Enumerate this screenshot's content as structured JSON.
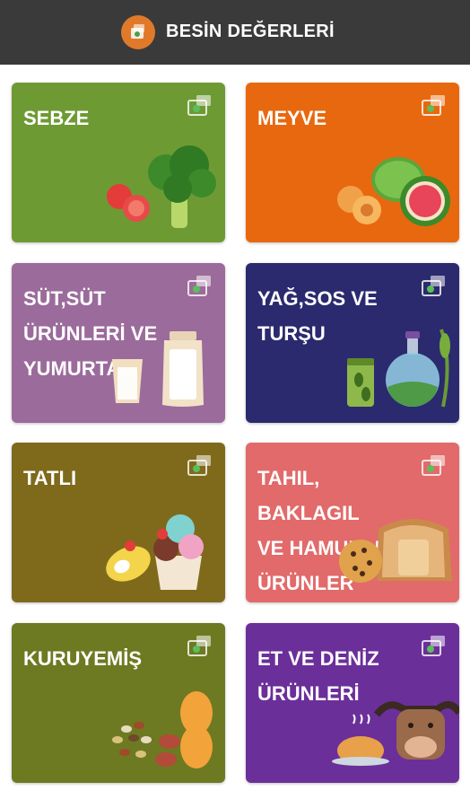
{
  "app": {
    "title": "BESİN DEĞERLERİ"
  },
  "categories": [
    {
      "label": "SEBZE",
      "color": "#6e9a34",
      "art": "vegetables-illustration"
    },
    {
      "label": "MEYVE",
      "color": "#e8680f",
      "art": "fruits-illustration"
    },
    {
      "label": "SÜT,SÜT\nÜRÜNLERİ VE\nYUMURTA",
      "color": "#9b6b9b",
      "art": "dairy-illustration"
    },
    {
      "label": "YAĞ,SOS VE\nTURŞU",
      "color": "#2b2a6e",
      "art": "oil-sauce-pickle-illustration"
    },
    {
      "label": "TATLI",
      "color": "#7f6a1c",
      "art": "dessert-illustration"
    },
    {
      "label": "TAHIL, BAKLAGIL\nVE HAMURLU\nÜRÜNLER",
      "color": "#e26a6a",
      "art": "bakery-illustration"
    },
    {
      "label": "KURUYEMİŞ",
      "color": "#6d7a22",
      "art": "nuts-illustration"
    },
    {
      "label": "ET VE DENİZ\nÜRÜNLERİ",
      "color": "#6b2f9a",
      "art": "meat-seafood-illustration"
    }
  ]
}
